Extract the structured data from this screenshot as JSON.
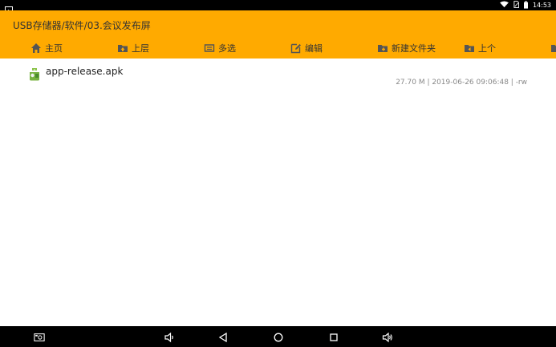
{
  "status_bar": {
    "time": "14:53"
  },
  "header": {
    "path": "USB存储器/软件/03.会议发布屏"
  },
  "toolbar": {
    "home": "主页",
    "up_level": "上层",
    "multi_select": "多选",
    "edit": "编辑",
    "new_folder": "新建文件夹",
    "previous": "上个"
  },
  "files": [
    {
      "name": "app-release.apk",
      "meta": "27.70 M | 2019-06-26 09:06:48 | -rw"
    }
  ],
  "colors": {
    "accent": "#ffaa00",
    "bars": "#000000"
  },
  "icons": {
    "status": [
      "image-icon",
      "wifi-icon",
      "sim-icon",
      "battery-icon"
    ],
    "toolbar": [
      "home-icon",
      "folder-up-icon",
      "multi-select-icon",
      "edit-icon",
      "new-folder-icon",
      "folder-prev-icon"
    ],
    "nav": [
      "screenshot-icon",
      "volume-down-icon",
      "back-icon",
      "home-circle-icon",
      "recents-icon",
      "volume-up-icon"
    ]
  }
}
